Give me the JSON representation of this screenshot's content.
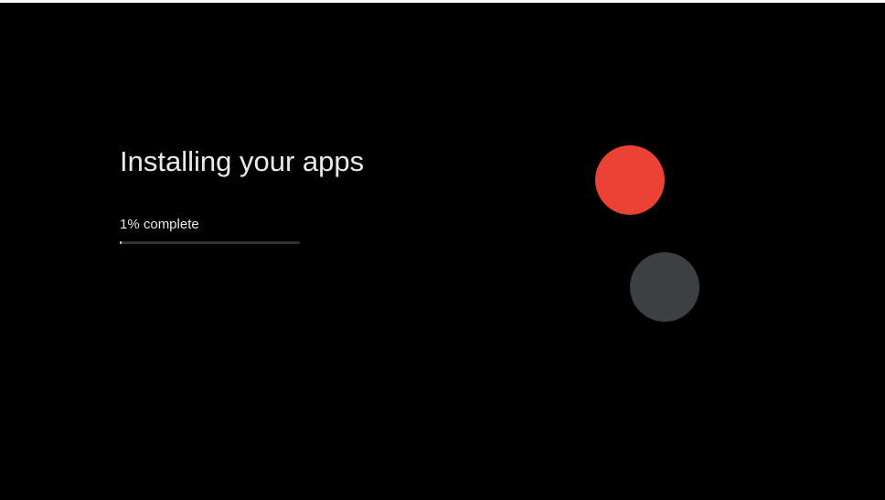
{
  "setup": {
    "title": "Installing your apps",
    "status_text": "1% complete",
    "progress_fraction": 0.01
  },
  "colors": {
    "background": "#000000",
    "text": "#e8eaed",
    "progress_track": "#303134",
    "progress_fill": "#e8eaed",
    "circle_red": "#ea4335",
    "circle_gray": "#3c4043"
  }
}
